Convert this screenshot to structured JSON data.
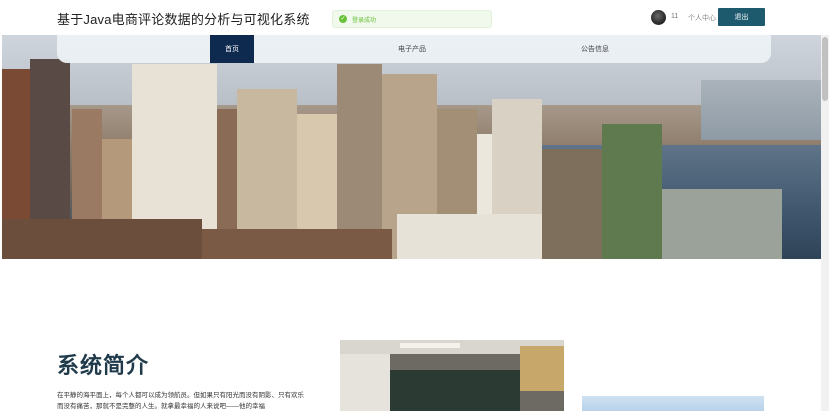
{
  "header": {
    "site_title": "基于Java电商评论数据的分析与可视化系统",
    "toast_message": "登录成功",
    "username": "11",
    "profile_link": "个人中心",
    "logout_label": "退出"
  },
  "nav": {
    "items": [
      {
        "label": "首页",
        "active": true
      },
      {
        "label": "电子产品",
        "active": false
      },
      {
        "label": "公告信息",
        "active": false
      }
    ]
  },
  "intro": {
    "title": "系统简介",
    "text": "在平静的海平面上，每个人都可以成为领航员。但如果只有阳光而没有阴影、只有欢乐而没有痛苦，那就不是完整的人生。就拿最幸福的人来说吧——他的幸福"
  },
  "colors": {
    "nav_active_bg": "#0f2a4f",
    "logout_bg": "#1e5a6e",
    "title_color": "#1f3a4a",
    "toast_green": "#67c23a"
  }
}
